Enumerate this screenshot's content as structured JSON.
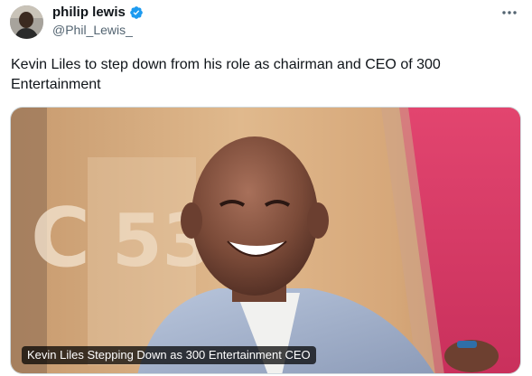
{
  "tweet": {
    "display_name": "philip lewis",
    "handle": "@Phil_Lewis_",
    "text": "Kevin Liles to step down from his role as chairman and CEO of 300 Entertainment",
    "media": {
      "caption": "Kevin Liles Stepping Down as 300 Entertainment CEO"
    }
  },
  "icons": {
    "verified": "verified-badge-icon",
    "more": "more-options-icon"
  },
  "colors": {
    "verified_blue": "#1d9bf0",
    "handle_gray": "#536471"
  }
}
